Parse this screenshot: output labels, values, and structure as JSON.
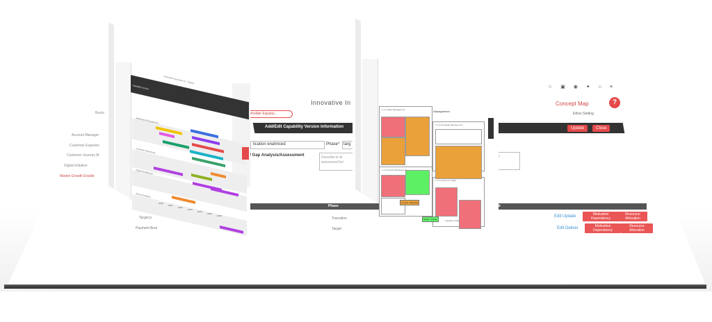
{
  "base": {
    "title": "Innovative In",
    "concept_map": "Concept Map",
    "help": "?",
    "user": "Ethos Setting",
    "header_icons": "☆ ▣ ◉ ✦ ⌂ ≡",
    "stakeholder_pill": "Stakeholder Expane...",
    "add_edit_title": "Add/Edit Capability Version Information",
    "update_label": "Update",
    "close_label": "Close",
    "field_application": "lication enahnced",
    "field_phase_label": "Phase*",
    "field_phase_value": "targ",
    "field_gap": "f Gap Analysis/Assessment",
    "hint_describe": "Describe le di",
    "hint_describe2": "announced bri",
    "hint_right": "ability",
    "phase_header": "Phase",
    "phase_header_right": "nt",
    "rows": [
      {
        "left": "Target p",
        "phase": "Transition"
      },
      {
        "left": "Payment Anal",
        "phase": "Target"
      }
    ],
    "links": [
      "Edit Update",
      "Edit Deliver"
    ],
    "chips": [
      "Motivation Dependency",
      "Resource Allocation"
    ],
    "sidebar": [
      {
        "label": "Account Manager",
        "red": false
      },
      {
        "label": "Customer Experien",
        "red": false
      },
      {
        "label": "Customer Journey M",
        "red": false
      },
      {
        "label": "Digital Initiative",
        "red": false
      },
      {
        "label": "Market Growth Enable",
        "red": true
      }
    ],
    "sidebar_top": "Business"
  },
  "left_panel": {
    "title": "Innovative Insurance Co - Targets",
    "dark_label": "Capability Version",
    "lanes": [
      "Application Management",
      "Customer Experience",
      "Digital Enablement",
      "Data & Analytics"
    ],
    "ticks": [
      "2020",
      "2021",
      "2022",
      "2023",
      "2024",
      "2025",
      "2026"
    ]
  },
  "right_panel": {
    "title": "1.1 Marketing Management",
    "cards": [
      "1.1.1 Sales Management",
      "1.1.2 Campaign Management",
      "1.1.3 Product Management",
      "1.1.4 Customer Insight"
    ],
    "legend": [
      "Current - Baseline",
      "Target - Future",
      "Transition State"
    ],
    "status_colors": {
      "red": "#f0707a",
      "orange": "#eaa13a",
      "green": "#5ef064"
    }
  }
}
